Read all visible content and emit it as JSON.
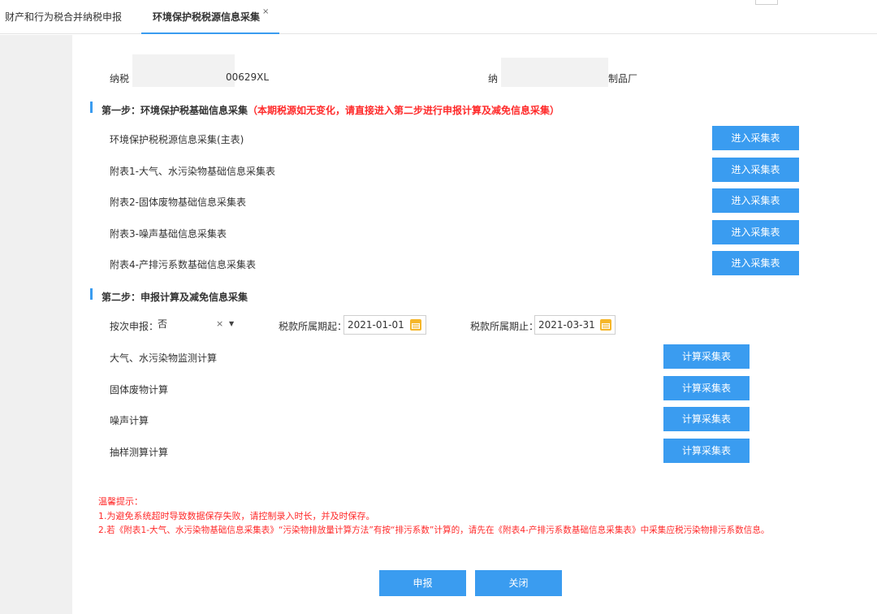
{
  "tabs": [
    {
      "label": "财产和行为税合并纳税申报"
    },
    {
      "label": "环境保护税税源信息采集",
      "close": "×"
    }
  ],
  "taxpayer": {
    "id_label": "纳税",
    "id_value_partial": "00629XL",
    "name_label": "纳",
    "name_value_partial": "制品厂"
  },
  "step1": {
    "title": "第一步：环境保护税基础信息采集",
    "note": "（本期税源如无变化，请直接进入第二步进行申报计算及减免信息采集）",
    "items": [
      {
        "label": "环境保护税税源信息采集(主表)",
        "button": "进入采集表"
      },
      {
        "label": "附表1-大气、水污染物基础信息采集表",
        "button": "进入采集表"
      },
      {
        "label": "附表2-固体废物基础信息采集表",
        "button": "进入采集表"
      },
      {
        "label": "附表3-噪声基础信息采集表",
        "button": "进入采集表"
      },
      {
        "label": "附表4-产排污系数基础信息采集表",
        "button": "进入采集表"
      }
    ]
  },
  "step2": {
    "title": "第二步：申报计算及减免信息采集",
    "filing_label": "按次申报：",
    "filing_value": "否",
    "clear_glyph": "×",
    "arrow_glyph": "▼",
    "period_start_label": "税款所属期起：",
    "period_start_value": "2021-01-01",
    "period_end_label": "税款所属期止：",
    "period_end_value": "2021-03-31",
    "items": [
      {
        "label": "大气、水污染物监测计算",
        "button": "计算采集表"
      },
      {
        "label": "固体废物计算",
        "button": "计算采集表"
      },
      {
        "label": "噪声计算",
        "button": "计算采集表"
      },
      {
        "label": "抽样测算计算",
        "button": "计算采集表"
      }
    ]
  },
  "tips": {
    "title": "温馨提示：",
    "line1": "1.为避免系统超时导致数据保存失败，请控制录入时长，并及时保存。",
    "line2": "2.若《附表1-大气、水污染物基础信息采集表》“污染物排放量计算方法”有按“排污系数”计算的，请先在《附表4-产排污系数基础信息采集表》中采集应税污染物排污系数信息。"
  },
  "actions": {
    "submit": "申报",
    "close": "关闭"
  },
  "colors": {
    "accent": "#3a9cf0",
    "warning": "#ff2a2a",
    "calendar": "#f5b629"
  }
}
